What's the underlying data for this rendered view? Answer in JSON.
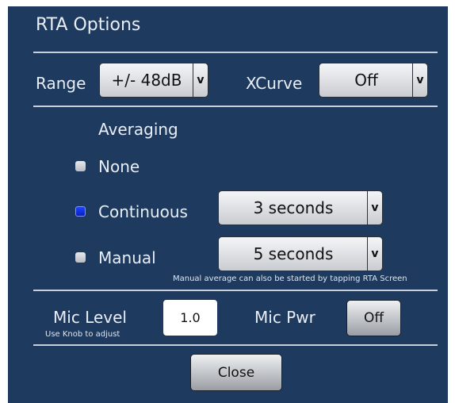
{
  "dialog": {
    "title": "RTA Options"
  },
  "range": {
    "label": "Range",
    "value": "+/- 48dB",
    "arrow": "v"
  },
  "xcurve": {
    "label": "XCurve",
    "value": "Off",
    "arrow": "v"
  },
  "averaging": {
    "heading": "Averaging",
    "options": [
      {
        "label": "None",
        "selected": false
      },
      {
        "label": "Continuous",
        "selected": true
      },
      {
        "label": "Manual",
        "selected": false
      }
    ],
    "continuous_duration": {
      "value": "3 seconds",
      "arrow": "v"
    },
    "manual_duration": {
      "value": "5 seconds",
      "arrow": "v"
    },
    "manual_note": "Manual average can also be started by tapping RTA Screen"
  },
  "mic": {
    "level_label": "Mic Level",
    "level_hint": "Use Knob to adjust",
    "level_value": "1.0",
    "pwr_label": "Mic Pwr",
    "pwr_value": "Off"
  },
  "footer": {
    "close_label": "Close"
  },
  "colors": {
    "panel": "#1e3a5f",
    "selected_radio": "#1a44ff"
  }
}
